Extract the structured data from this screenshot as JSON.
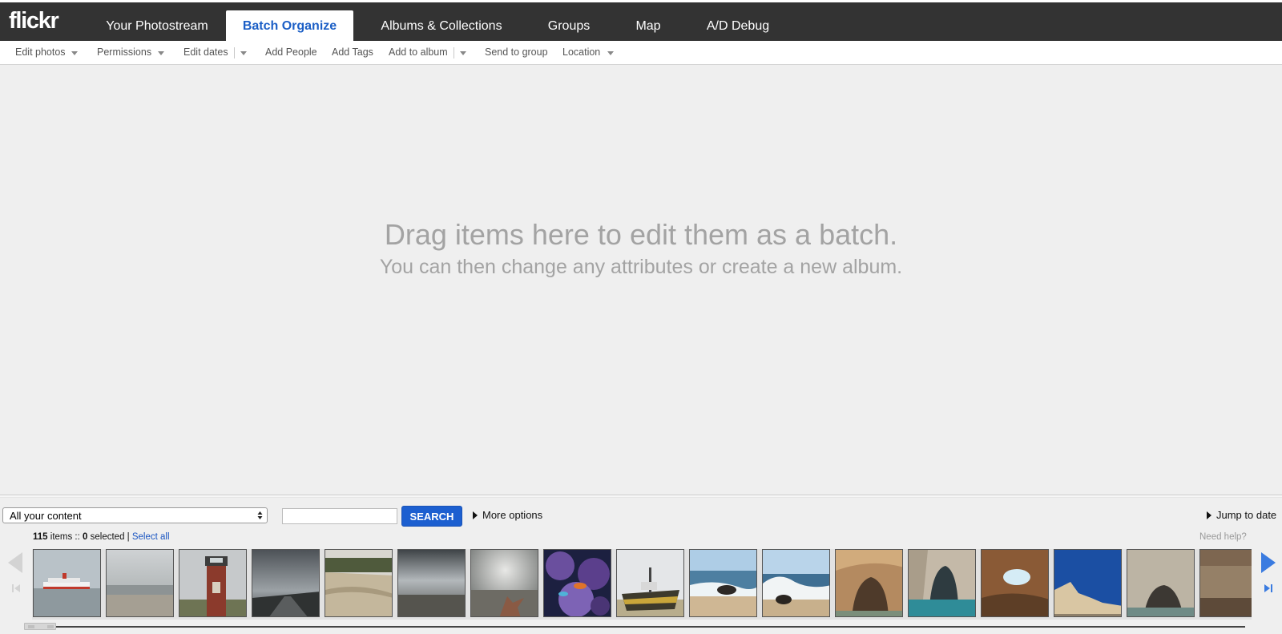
{
  "app": {
    "logo": "flickr"
  },
  "nav": {
    "tabs": [
      {
        "label": "Your Photostream",
        "active": false
      },
      {
        "label": "Batch Organize",
        "active": true
      },
      {
        "label": "Albums & Collections",
        "active": false
      },
      {
        "label": "Groups",
        "active": false
      },
      {
        "label": "Map",
        "active": false
      },
      {
        "label": "A/D Debug",
        "active": false
      }
    ]
  },
  "toolbar": {
    "items": [
      {
        "label": "Edit photos",
        "has_menu": true
      },
      {
        "label": "Permissions",
        "has_menu": true
      },
      {
        "label": "Edit dates",
        "has_menu": true
      },
      {
        "label": "Add People",
        "has_menu": false
      },
      {
        "label": "Add Tags",
        "has_menu": false
      },
      {
        "label": "Add to album",
        "has_menu": true
      },
      {
        "label": "Send to group",
        "has_menu": false
      },
      {
        "label": "Location",
        "has_menu": true
      }
    ]
  },
  "dropzone": {
    "title": "Drag items here to edit them as a batch.",
    "subtitle": "You can then change any attributes or create a new album."
  },
  "filter": {
    "content_selected": "All your content",
    "search_value": "",
    "search_label": "SEARCH",
    "more_options": "More options",
    "jump_to_date": "Jump to date"
  },
  "status": {
    "item_count": "115",
    "items_label": "items ::",
    "selected_count": "0",
    "selected_label": "selected |",
    "select_all": "Select all",
    "need_help": "Need help?"
  },
  "filmstrip": {
    "photos": [
      {
        "subject": "ferry on grey sea"
      },
      {
        "subject": "overcast coastline"
      },
      {
        "subject": "red lighthouse"
      },
      {
        "subject": "dark clouds over path"
      },
      {
        "subject": "sand dunes"
      },
      {
        "subject": "cloudy sky over shore"
      },
      {
        "subject": "starfish on sand"
      },
      {
        "subject": "aquarium coral"
      },
      {
        "subject": "ship on beach"
      },
      {
        "subject": "waves on rocks"
      },
      {
        "subject": "surf on shore"
      },
      {
        "subject": "rock arch"
      },
      {
        "subject": "sea cave with water"
      },
      {
        "subject": "cave opening to sky"
      },
      {
        "subject": "cliffs under blue sky"
      },
      {
        "subject": "sea cave"
      },
      {
        "subject": "rock wall"
      }
    ]
  },
  "colors": {
    "nav_background": "#333333",
    "active_tab_text": "#1c5fc6",
    "search_button": "#1c5fd0",
    "link": "#1a55c2"
  }
}
